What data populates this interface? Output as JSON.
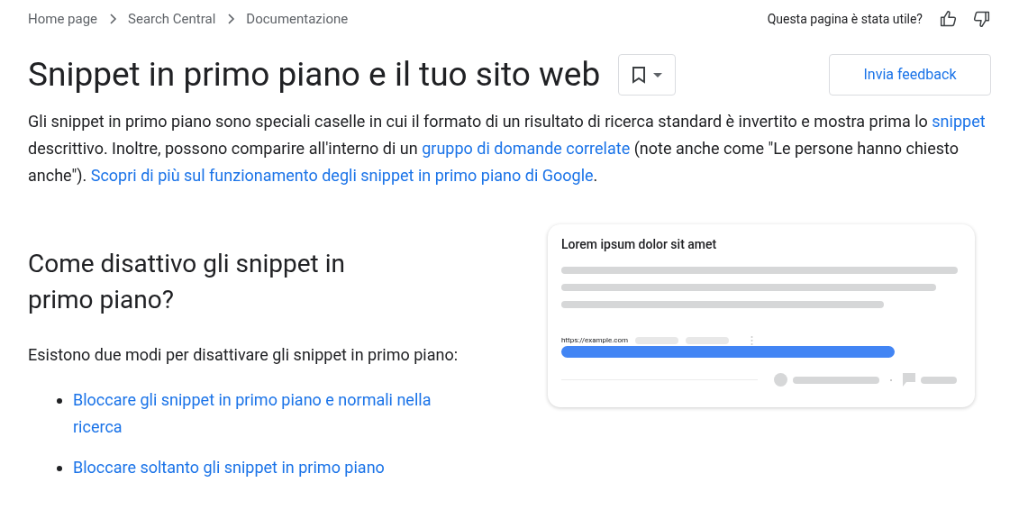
{
  "breadcrumbs": [
    "Home page",
    "Search Central",
    "Documentazione"
  ],
  "feedback_prompt": "Questa pagina è stata utile?",
  "title": "Snippet in primo piano e il tuo sito web",
  "feedback_button": "Invia feedback",
  "intro": [
    {
      "kind": "text",
      "text": "Gli snippet in primo piano sono speciali caselle in cui il formato di un risultato di ricerca standard è invertito e mostra prima lo "
    },
    {
      "kind": "link",
      "text": "snippet"
    },
    {
      "kind": "text",
      "text": " descrittivo. Inoltre, possono comparire all'interno di un "
    },
    {
      "kind": "link",
      "text": "gruppo di domande correlate"
    },
    {
      "kind": "text",
      "text": " (note anche come \"Le persone hanno chiesto anche\"). "
    },
    {
      "kind": "link",
      "text": "Scopri di più sul funzionamento degli snippet in primo piano di Google"
    },
    {
      "kind": "text",
      "text": "."
    }
  ],
  "section": {
    "heading": "Come disattivo gli snippet in primo piano?",
    "body": "Esistono due modi per disattivare gli snippet in primo piano:",
    "links": [
      "Bloccare gli snippet in primo piano e normali nella ricerca",
      "Bloccare soltanto gli snippet in primo piano"
    ]
  },
  "illustration": {
    "title": "Lorem ipsum dolor sit amet",
    "url": "https://example.com"
  }
}
